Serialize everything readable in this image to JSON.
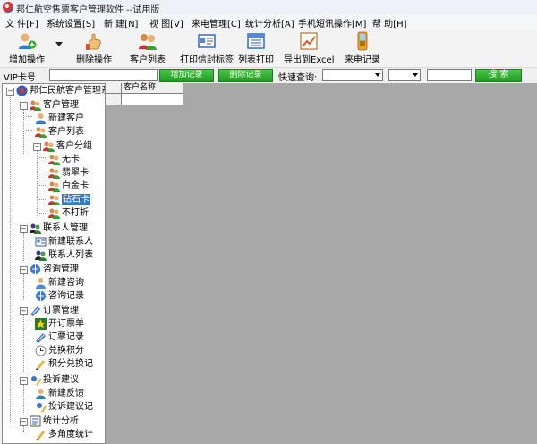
{
  "window": {
    "title": "邦仁航空售票客户管理软件 --试用版"
  },
  "menu": [
    "文 件[F]",
    "系统设置[S]",
    "新 建[N]",
    "视 图[V]",
    "来电管理[C]",
    "统计分析[A]",
    "手机短讯操作[M]",
    "帮 助[H]"
  ],
  "toolbar": {
    "add": "增加操作",
    "delete": "删除操作",
    "customer_list": "客户列表",
    "print_labels": "打印信封标签",
    "print_list": "列表打印",
    "export_excel": "导出到Excel",
    "call_log": "来电记录"
  },
  "filter": {
    "vip_label": "VIP卡号",
    "add_record": "增加记录",
    "delete_record": "删除记录",
    "quick_query": "快速查询:",
    "search": "搜 索"
  },
  "tree": {
    "root": "邦仁民航客户管理系",
    "customers": "客户管理",
    "new_customer": "新建客户",
    "customer_list": "客户列表",
    "customer_groups": "客户分组",
    "no_card": "无卡",
    "jade_card": "翡翠卡",
    "platinum_card": "白金卡",
    "diamond_card": "钻石卡",
    "no_discount": "不打折",
    "contacts": "联系人管理",
    "new_contact": "新建联系人",
    "contact_list": "联系人列表",
    "consult": "咨询管理",
    "new_consult": "新建咨询",
    "consult_records": "咨询记录",
    "orders": "订票管理",
    "open_ticket": "开订票单",
    "order_records": "订票记录",
    "redeem_points": "兑换积分",
    "points_records": "积分兑换记",
    "complaints": "投诉建议",
    "new_feedback": "新建反馈",
    "complaint_records": "投诉建议记",
    "stats": "统计分析",
    "multi_stats": "多角度统计"
  },
  "grid": {
    "column": "客户名称"
  },
  "colors": {
    "accent": "#3478d0",
    "green_button": "#2aa52a"
  }
}
